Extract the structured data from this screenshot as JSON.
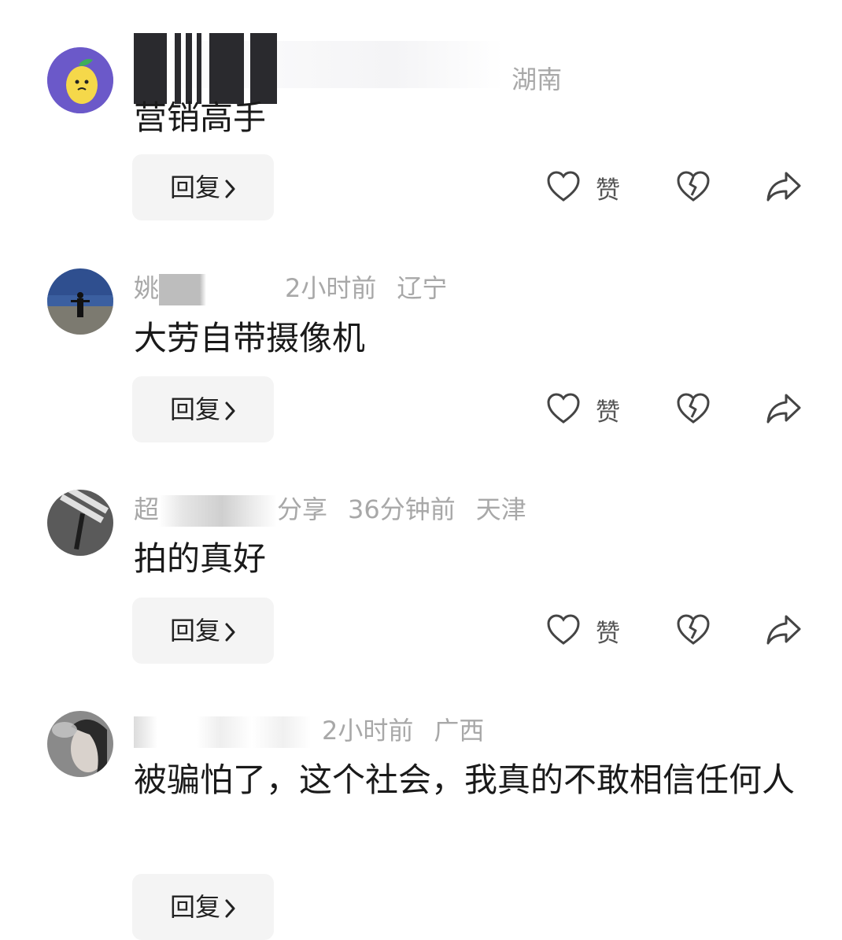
{
  "comments": [
    {
      "name_visible": "",
      "time": "",
      "location": "湖南",
      "text": "营销高手",
      "reply_label": "回复",
      "like_label": "赞"
    },
    {
      "name_visible": "姚",
      "time": "2小时前",
      "location": "辽宁",
      "text": "大劳自带摄像机",
      "reply_label": "回复",
      "like_label": "赞"
    },
    {
      "name_visible": "超",
      "name_tail": "分享",
      "time": "36分钟前",
      "location": "天津",
      "text": "拍的真好",
      "reply_label": "回复",
      "like_label": "赞"
    },
    {
      "name_visible": "",
      "time": "2小时前",
      "location": "广西",
      "text": "被骗怕了，这个社会，我真的不敢相信任何人",
      "reply_label": "回复"
    }
  ],
  "icons": {
    "like": "heart-outline-icon",
    "dislike": "broken-heart-icon",
    "share": "share-arrow-icon"
  },
  "colors": {
    "meta_text": "#a8a8a8",
    "body_text": "#1a1a1a",
    "reply_bg": "#f4f4f4",
    "icon": "#444444"
  }
}
